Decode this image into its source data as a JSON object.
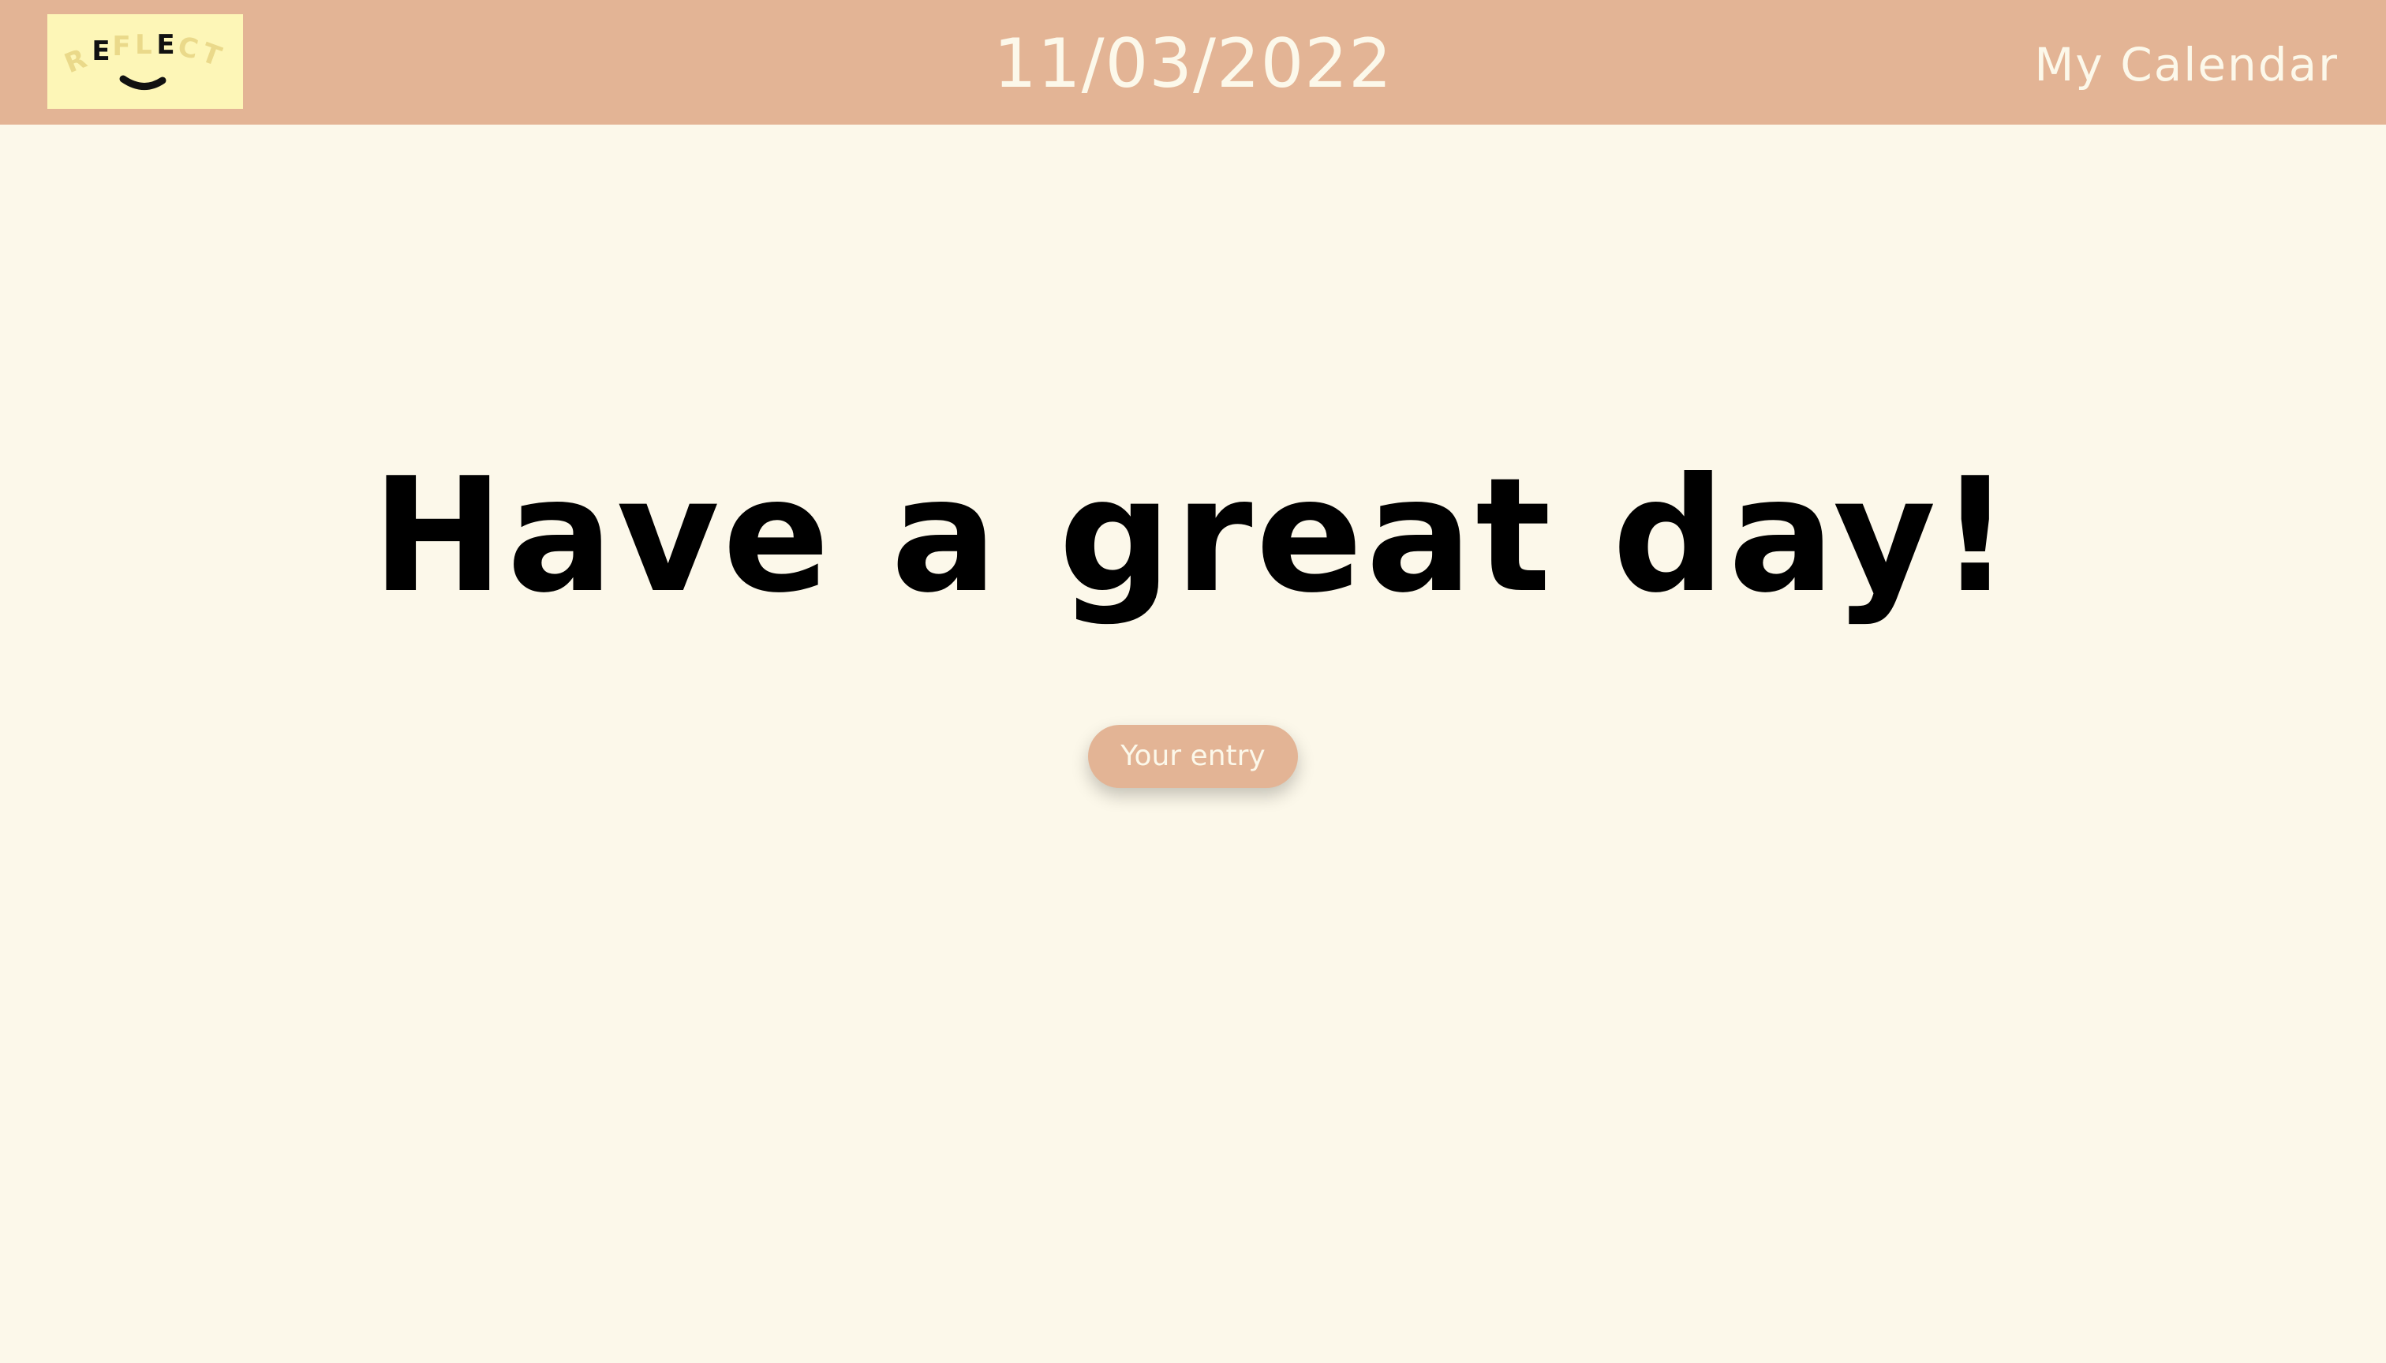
{
  "header": {
    "logo_text": "REFLECT",
    "date": "11/03/2022",
    "calendar_link": "My Calendar"
  },
  "main": {
    "greeting": "Have a great day!",
    "entry_button": "Your entry"
  },
  "colors": {
    "header_bg": "#e3b495",
    "page_bg": "#fcf8ea",
    "logo_bg": "#fdf6b7",
    "text_light": "#fcf8ea",
    "text_dark": "#000000"
  }
}
